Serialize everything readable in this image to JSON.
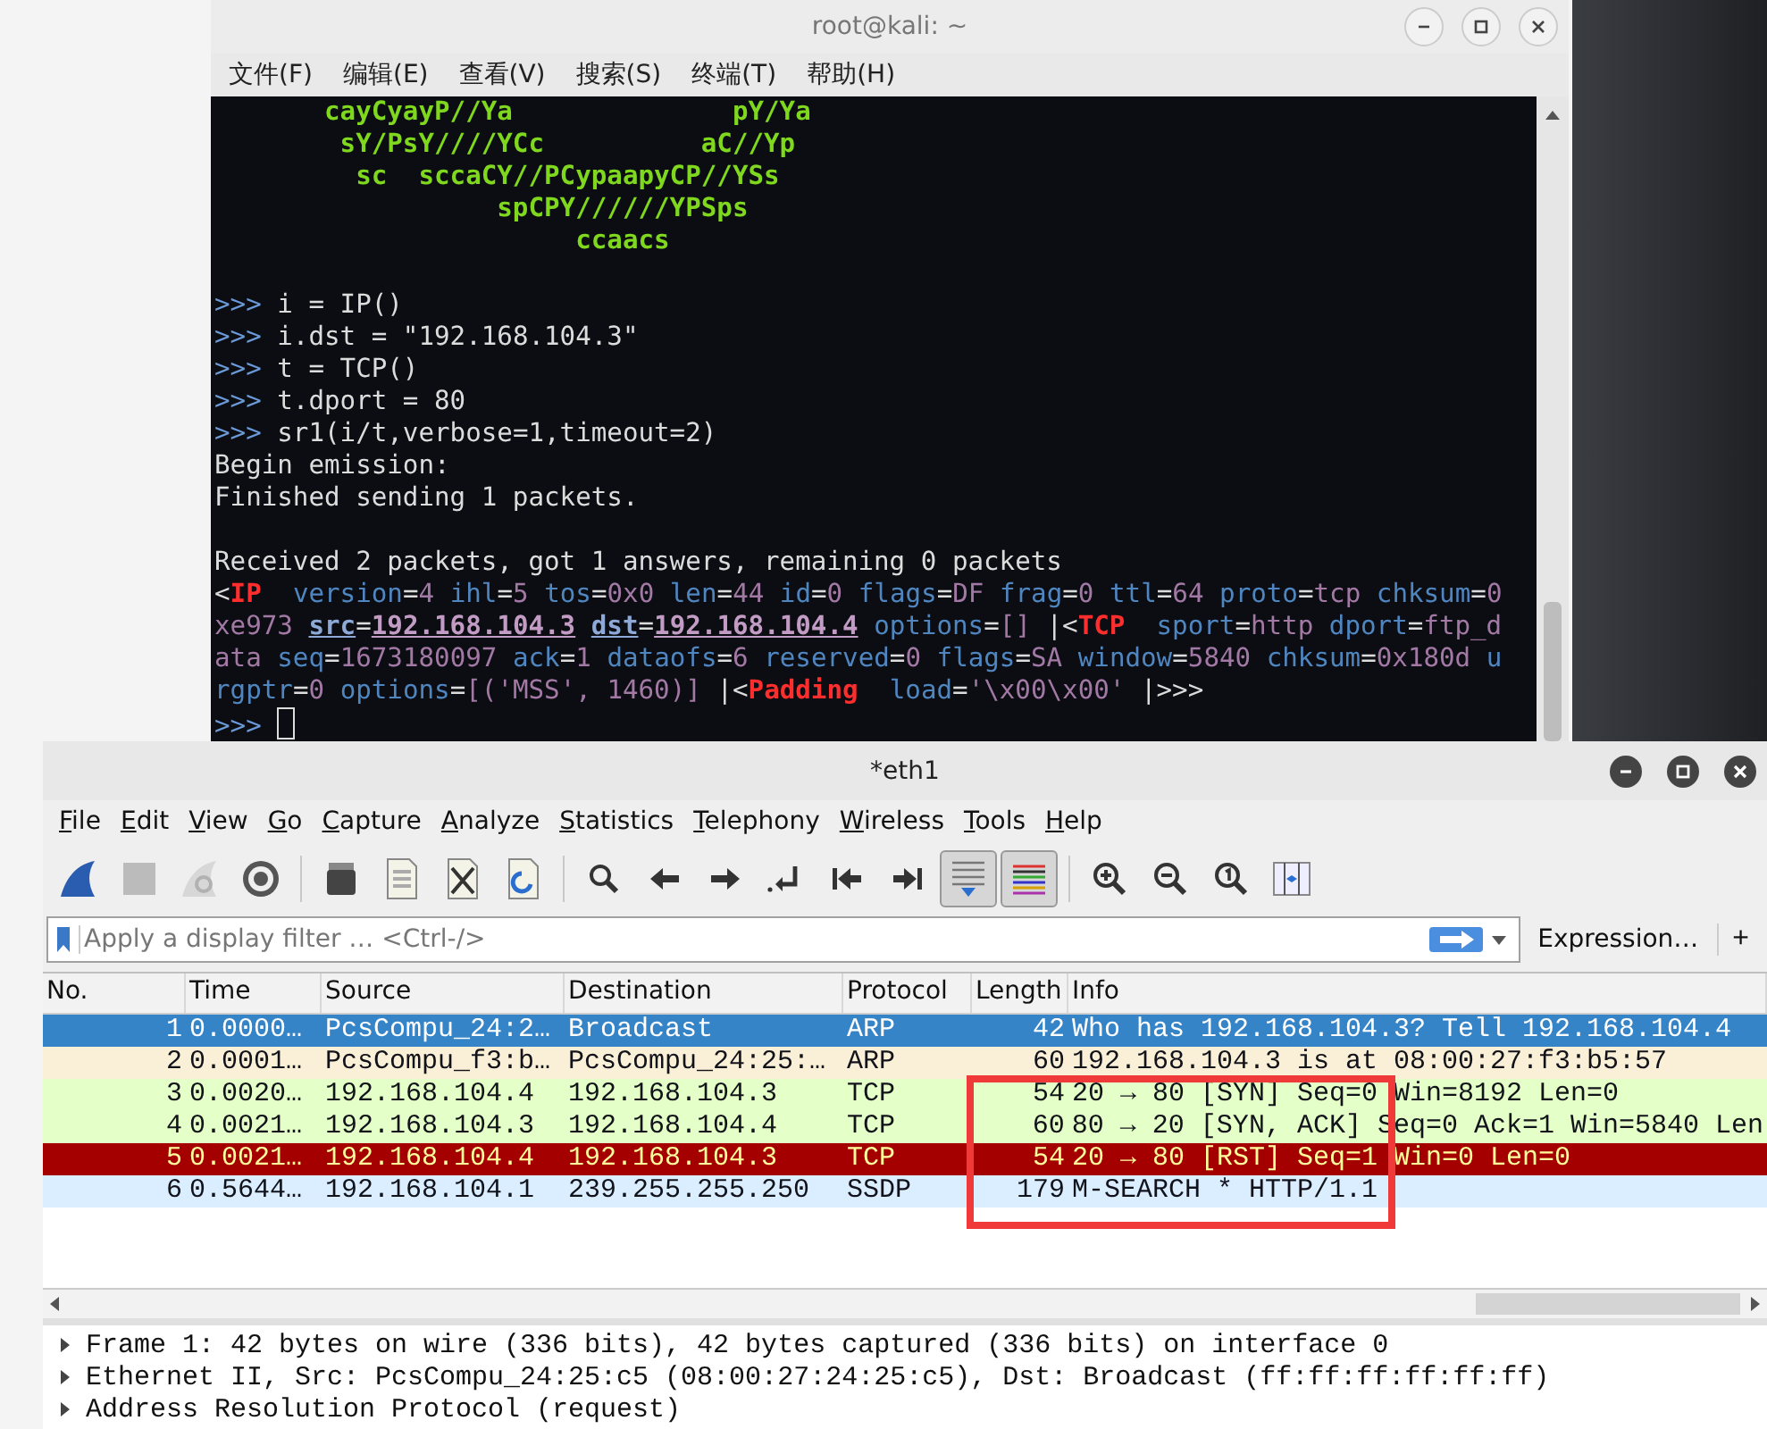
{
  "terminal": {
    "title": "root@kali: ~",
    "menu": [
      "文件(F)",
      "编辑(E)",
      "查看(V)",
      "搜索(S)",
      "终端(T)",
      "帮助(H)"
    ],
    "lines": [
      {
        "kind": "text",
        "segments": [
          {
            "text": "       cayCyayP//Ya              pY/Ya",
            "kind": "ascii"
          }
        ]
      },
      {
        "kind": "text",
        "segments": [
          {
            "text": "        sY/PsY////YCc          aC//Yp",
            "kind": "ascii"
          }
        ]
      },
      {
        "kind": "text",
        "segments": [
          {
            "text": "         sc  sccaCY//PCypaapyCP//YSs",
            "kind": "ascii"
          }
        ]
      },
      {
        "kind": "text",
        "segments": [
          {
            "text": "                  spCPY//////YPSps",
            "kind": "ascii"
          }
        ]
      },
      {
        "kind": "text",
        "segments": [
          {
            "text": "                       ccaacs",
            "kind": "ascii"
          }
        ]
      },
      {
        "kind": "blank"
      },
      {
        "kind": "text",
        "segments": [
          {
            "text": ">>>",
            "kind": "prompt"
          },
          {
            "text": " i = IP()",
            "kind": "plain"
          }
        ]
      },
      {
        "kind": "text",
        "segments": [
          {
            "text": ">>>",
            "kind": "prompt"
          },
          {
            "text": " i.dst = \"192.168.104.3\"",
            "kind": "plain"
          }
        ]
      },
      {
        "kind": "text",
        "segments": [
          {
            "text": ">>>",
            "kind": "prompt"
          },
          {
            "text": " t = TCP()",
            "kind": "plain"
          }
        ]
      },
      {
        "kind": "text",
        "segments": [
          {
            "text": ">>>",
            "kind": "prompt"
          },
          {
            "text": " t.dport = 80",
            "kind": "plain"
          }
        ]
      },
      {
        "kind": "text",
        "segments": [
          {
            "text": ">>>",
            "kind": "prompt"
          },
          {
            "text": " sr1(i/t,verbose=1,timeout=2)",
            "kind": "plain"
          }
        ]
      },
      {
        "kind": "text",
        "segments": [
          {
            "text": "Begin emission:",
            "kind": "plain"
          }
        ]
      },
      {
        "kind": "text",
        "segments": [
          {
            "text": "Finished sending 1 packets.",
            "kind": "plain"
          }
        ]
      },
      {
        "kind": "blank"
      },
      {
        "kind": "text",
        "segments": [
          {
            "text": "Received 2 packets, got 1 answers, remaining 0 packets",
            "kind": "plain"
          }
        ]
      },
      {
        "kind": "text",
        "segments": [
          {
            "text": "<",
            "kind": "plain"
          },
          {
            "text": "IP",
            "kind": "tag"
          },
          {
            "text": "  version",
            "kind": "key"
          },
          {
            "text": "=",
            "kind": "plain"
          },
          {
            "text": "4",
            "kind": "value"
          },
          {
            "text": " ihl",
            "kind": "key"
          },
          {
            "text": "=",
            "kind": "plain"
          },
          {
            "text": "5",
            "kind": "value"
          },
          {
            "text": " tos",
            "kind": "key"
          },
          {
            "text": "=",
            "kind": "plain"
          },
          {
            "text": "0x0",
            "kind": "value"
          },
          {
            "text": " len",
            "kind": "key"
          },
          {
            "text": "=",
            "kind": "plain"
          },
          {
            "text": "44",
            "kind": "value"
          },
          {
            "text": " id",
            "kind": "key"
          },
          {
            "text": "=",
            "kind": "plain"
          },
          {
            "text": "0",
            "kind": "value"
          },
          {
            "text": " flags",
            "kind": "key"
          },
          {
            "text": "=",
            "kind": "plain"
          },
          {
            "text": "DF",
            "kind": "value"
          },
          {
            "text": " frag",
            "kind": "key"
          },
          {
            "text": "=",
            "kind": "plain"
          },
          {
            "text": "0",
            "kind": "value"
          },
          {
            "text": " ttl",
            "kind": "key"
          },
          {
            "text": "=",
            "kind": "plain"
          },
          {
            "text": "64",
            "kind": "value"
          },
          {
            "text": " proto",
            "kind": "key"
          },
          {
            "text": "=",
            "kind": "plain"
          },
          {
            "text": "tcp",
            "kind": "value"
          },
          {
            "text": " chksum",
            "kind": "key"
          },
          {
            "text": "=",
            "kind": "plain"
          },
          {
            "text": "0",
            "kind": "value"
          }
        ]
      },
      {
        "kind": "text",
        "segments": [
          {
            "text": "xe973",
            "kind": "value"
          },
          {
            "text": "src",
            "kind": "key_link"
          },
          {
            "text": "=",
            "kind": "plain"
          },
          {
            "text": "192.168.104.3",
            "kind": "value_link"
          },
          {
            "text": "dst",
            "kind": "key_link"
          },
          {
            "text": "=",
            "kind": "plain"
          },
          {
            "text": "192.168.104.4",
            "kind": "value_link"
          },
          {
            "text": " options",
            "kind": "key"
          },
          {
            "text": "=",
            "kind": "plain"
          },
          {
            "text": "[]",
            "kind": "value"
          },
          {
            "text": " |<",
            "kind": "plain"
          },
          {
            "text": "TCP",
            "kind": "tag"
          },
          {
            "text": "  sport",
            "kind": "key"
          },
          {
            "text": "=",
            "kind": "plain"
          },
          {
            "text": "http",
            "kind": "value"
          },
          {
            "text": " dport",
            "kind": "key"
          },
          {
            "text": "=",
            "kind": "plain"
          },
          {
            "text": "ftp_d",
            "kind": "value"
          }
        ]
      },
      {
        "kind": "text",
        "segments": [
          {
            "text": "ata",
            "kind": "value"
          },
          {
            "text": " seq",
            "kind": "key"
          },
          {
            "text": "=",
            "kind": "plain"
          },
          {
            "text": "1673180097",
            "kind": "value"
          },
          {
            "text": " ack",
            "kind": "key"
          },
          {
            "text": "=",
            "kind": "plain"
          },
          {
            "text": "1",
            "kind": "value"
          },
          {
            "text": " dataofs",
            "kind": "key"
          },
          {
            "text": "=",
            "kind": "plain"
          },
          {
            "text": "6",
            "kind": "value"
          },
          {
            "text": " reserved",
            "kind": "key"
          },
          {
            "text": "=",
            "kind": "plain"
          },
          {
            "text": "0",
            "kind": "value"
          },
          {
            "text": " flags",
            "kind": "key"
          },
          {
            "text": "=",
            "kind": "plain"
          },
          {
            "text": "SA",
            "kind": "value"
          },
          {
            "text": " window",
            "kind": "key"
          },
          {
            "text": "=",
            "kind": "plain"
          },
          {
            "text": "5840",
            "kind": "value"
          },
          {
            "text": " chksum",
            "kind": "key"
          },
          {
            "text": "=",
            "kind": "plain"
          },
          {
            "text": "0x180d",
            "kind": "value"
          },
          {
            "text": " u",
            "kind": "key"
          }
        ]
      },
      {
        "kind": "text",
        "segments": [
          {
            "text": "rgptr",
            "kind": "key"
          },
          {
            "text": "=",
            "kind": "plain"
          },
          {
            "text": "0",
            "kind": "value"
          },
          {
            "text": " options",
            "kind": "key"
          },
          {
            "text": "=",
            "kind": "plain"
          },
          {
            "text": "[('MSS', 1460)]",
            "kind": "value"
          },
          {
            "text": " |<",
            "kind": "plain"
          },
          {
            "text": "Padding",
            "kind": "tag"
          },
          {
            "text": "  load",
            "kind": "key"
          },
          {
            "text": "=",
            "kind": "plain"
          },
          {
            "text": "'\\x00\\x00'",
            "kind": "value"
          },
          {
            "text": " |>>>",
            "kind": "plain"
          }
        ]
      },
      {
        "kind": "text",
        "segments": [
          {
            "text": ">>>",
            "kind": "prompt"
          },
          {
            "kind": "cursor"
          }
        ]
      }
    ]
  },
  "wireshark": {
    "title": "*eth1",
    "menu": [
      "File",
      "Edit",
      "View",
      "Go",
      "Capture",
      "Analyze",
      "Statistics",
      "Telephony",
      "Wireless",
      "Tools",
      "Help"
    ],
    "toolbar": [
      {
        "kind": "start",
        "pressed": false,
        "disabled": false
      },
      {
        "kind": "stop",
        "pressed": false,
        "disabled": true
      },
      {
        "kind": "restart",
        "pressed": false,
        "disabled": true
      },
      {
        "kind": "options",
        "pressed": false,
        "disabled": false
      },
      {
        "kind": "separator"
      },
      {
        "kind": "open",
        "pressed": false,
        "disabled": false
      },
      {
        "kind": "save",
        "pressed": false,
        "disabled": false
      },
      {
        "kind": "close",
        "pressed": false,
        "disabled": false
      },
      {
        "kind": "reload",
        "pressed": false,
        "disabled": false
      },
      {
        "kind": "separator"
      },
      {
        "kind": "find",
        "pressed": false,
        "disabled": false
      },
      {
        "kind": "back",
        "pressed": false,
        "disabled": false
      },
      {
        "kind": "forward",
        "pressed": false,
        "disabled": false
      },
      {
        "kind": "goto",
        "pressed": false,
        "disabled": false
      },
      {
        "kind": "first",
        "pressed": false,
        "disabled": false
      },
      {
        "kind": "last",
        "pressed": false,
        "disabled": false
      },
      {
        "kind": "autoscroll",
        "pressed": true,
        "disabled": false
      },
      {
        "kind": "colorize",
        "pressed": true,
        "disabled": false
      },
      {
        "kind": "separator"
      },
      {
        "kind": "zoom_in",
        "pressed": false,
        "disabled": false
      },
      {
        "kind": "zoom_out",
        "pressed": false,
        "disabled": false
      },
      {
        "kind": "zoom_reset",
        "pressed": false,
        "disabled": false
      },
      {
        "kind": "resize",
        "pressed": false,
        "disabled": false
      }
    ],
    "filter": {
      "placeholder": "Apply a display filter … <Ctrl-/>",
      "expression": "Expression…",
      "add": "+"
    },
    "columns": [
      "No.",
      "Time",
      "Source",
      "Destination",
      "Protocol",
      "Length",
      "Info"
    ],
    "rows": [
      {
        "cells": [
          "1",
          "0.0000…",
          "PcsCompu_24:2…",
          "Broadcast",
          "ARP",
          "42",
          "Who has 192.168.104.3? Tell 192.168.104.4"
        ],
        "selected": true
      },
      {
        "cells": [
          "2",
          "0.0001…",
          "PcsCompu_f3:b…",
          "PcsCompu_24:25:…",
          "ARP",
          "60",
          "192.168.104.3 is at 08:00:27:f3:b5:57"
        ],
        "color": "#faf0d7",
        "kind": "normal",
        "selected": false
      },
      {
        "cells": [
          "3",
          "0.0020…",
          "192.168.104.4",
          "192.168.104.3",
          "TCP",
          "54",
          "20 → 80 [SYN] Seq=0 Win=8192 Len=0"
        ],
        "color": "#e4ffc7",
        "kind": "normal",
        "selected": false
      },
      {
        "cells": [
          "4",
          "0.0021…",
          "192.168.104.3",
          "192.168.104.4",
          "TCP",
          "60",
          "80 → 20 [SYN, ACK] Seq=0 Ack=1 Win=5840 Len"
        ],
        "color": "#e4ffc7",
        "kind": "normal",
        "selected": false
      },
      {
        "cells": [
          "5",
          "0.0021…",
          "192.168.104.4",
          "192.168.104.3",
          "TCP",
          "54",
          "20 → 80 [RST] Seq=1 Win=0 Len=0"
        ],
        "color": "#a40000",
        "kind": "alert",
        "selected": false
      },
      {
        "cells": [
          "6",
          "0.5644…",
          "192.168.104.1",
          "239.255.255.250",
          "SSDP",
          "179",
          "M-SEARCH * HTTP/1.1"
        ],
        "color": "#daeeff",
        "kind": "normal",
        "selected": false
      }
    ],
    "details": [
      {
        "text": "Frame 1: 42 bytes on wire (336 bits), 42 bytes captured (336 bits) on interface 0",
        "expanded": false
      },
      {
        "text": "Ethernet II, Src: PcsCompu_24:25:c5 (08:00:27:24:25:c5), Dst: Broadcast (ff:ff:ff:ff:ff:ff)",
        "expanded": false
      },
      {
        "text": "Address Resolution Protocol (request)",
        "expanded": false
      }
    ]
  }
}
